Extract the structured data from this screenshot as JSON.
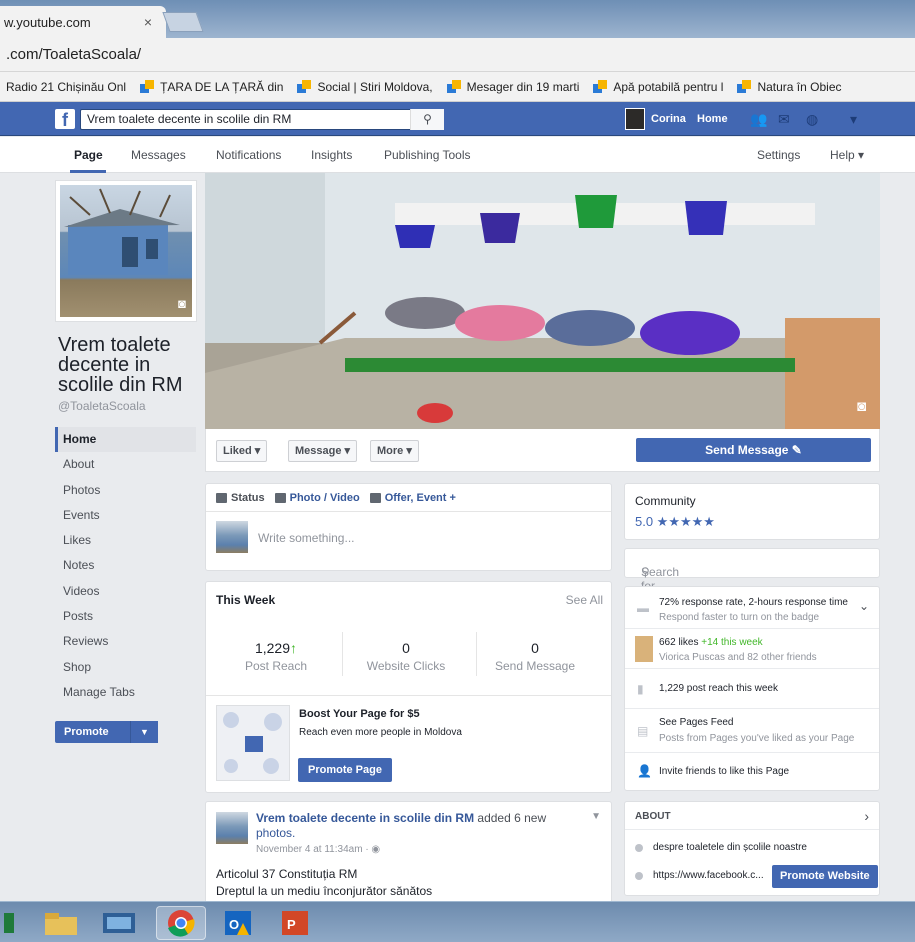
{
  "browser": {
    "tab_title": "w.youtube.com",
    "tab_close": "×",
    "address": ".com/ToaletaScoala/",
    "bookmarks": [
      "Radio 21 Chișinău Onl",
      "ȚARA DE LA ȚARĂ din",
      "Social | Stiri Moldova,",
      "Mesager din 19 marti",
      "Apă potabilă pentru l",
      "Natura în Obiec"
    ]
  },
  "fbbar": {
    "search_value": "Vrem toalete decente in scolile din RM",
    "user_name": "Corina",
    "home_label": "Home"
  },
  "page_tabs": {
    "page": "Page",
    "messages": "Messages",
    "notifications": "Notifications",
    "insights": "Insights",
    "publishing_tools": "Publishing Tools",
    "settings": "Settings",
    "help": "Help ▾"
  },
  "page": {
    "name": "Vrem toalete decente in scolile din RM",
    "handle": "@ToaletaScoala"
  },
  "left_nav": [
    "Home",
    "About",
    "Photos",
    "Events",
    "Likes",
    "Notes",
    "Videos",
    "Posts",
    "Reviews",
    "Shop",
    "Manage Tabs"
  ],
  "promote_label": "Promote",
  "actions": {
    "liked": "Liked ▾",
    "message": "Message ▾",
    "more": "More ▾",
    "send_message": "Send Message ✎"
  },
  "composer": {
    "status": "Status",
    "photo_video": "Photo / Video",
    "offer_event": "Offer, Event +",
    "placeholder": "Write something..."
  },
  "this_week": {
    "title": "This Week",
    "see_all": "See All",
    "stats": [
      {
        "value": "1,229",
        "label": "Post Reach"
      },
      {
        "value": "0",
        "label": "Website Clicks"
      },
      {
        "value": "0",
        "label": "Send Message"
      }
    ],
    "boost_title": "Boost Your Page for $5",
    "boost_sub": "Reach even more people in Moldova",
    "boost_button": "Promote Page"
  },
  "post": {
    "author": "Vrem toalete decente in scolile din RM",
    "action": " added 6 new",
    "photos": "photos.",
    "date": "November 4 at 11:34am · ◉",
    "body_line1": "Articolul 37 Constituția RM",
    "body_line2": "Dreptul la un mediu înconjurător sănătos"
  },
  "community": {
    "title": "Community",
    "rating": "5.0 ★★★★★"
  },
  "search_posts_placeholder": "Search for posts on this Page",
  "stats_panel": {
    "response_1": "72% response rate, 2-hours response time",
    "response_2": "Respond faster to turn on the badge",
    "likes_1": "662 likes",
    "likes_new": "+14 this week",
    "likes_2": "Viorica Puscas and 82 other friends",
    "reach": "1,229 post reach this week",
    "feed_1": "See Pages Feed",
    "feed_2": "Posts from Pages you've liked as your Page",
    "invite": "Invite friends to like this Page"
  },
  "about": {
    "title": "ABOUT",
    "desc": "despre toaletele din școlile noastre",
    "url": "https://www.facebook.c...",
    "button": "Promote Website"
  },
  "colors": {
    "fb_blue": "#4267b2",
    "link_blue": "#365899",
    "green": "#42b72a"
  }
}
